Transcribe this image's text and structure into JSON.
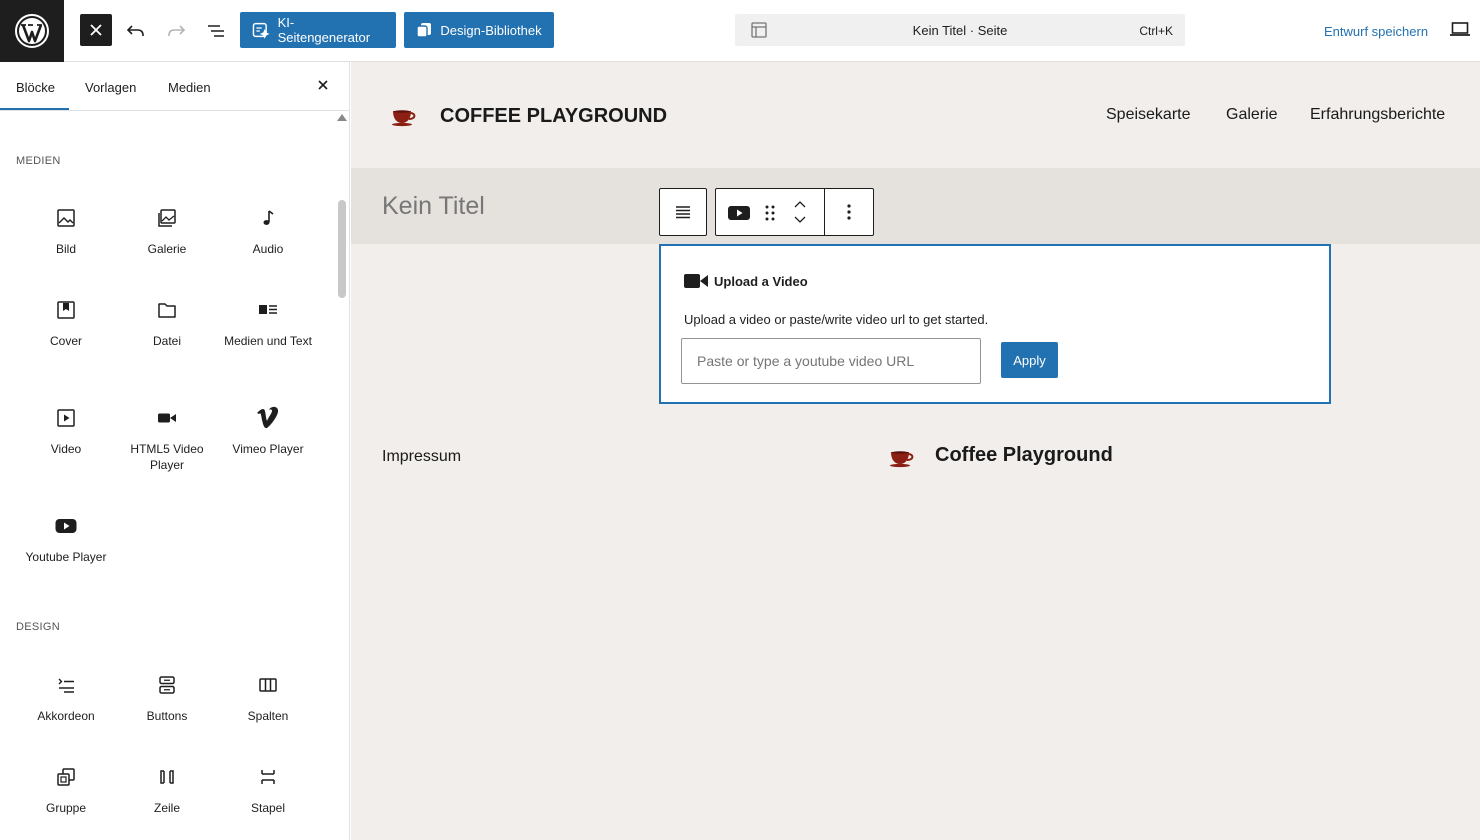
{
  "topbar": {
    "ki_button": "KI-Seitengenerator",
    "library_button": "Design-Bibliothek",
    "command_title": "Kein Titel · Seite",
    "command_shortcut": "Ctrl+K",
    "save_draft": "Entwurf speichern"
  },
  "sidebar": {
    "tabs": [
      "Blöcke",
      "Vorlagen",
      "Medien"
    ],
    "categories": {
      "media": "MEDIEN",
      "design": "DESIGN"
    },
    "blocks": {
      "bild": "Bild",
      "galerie": "Galerie",
      "audio": "Audio",
      "cover": "Cover",
      "datei": "Datei",
      "medien_text": "Medien und Text",
      "video": "Video",
      "html5_video": "HTML5 Video Player",
      "vimeo": "Vimeo Player",
      "youtube": "Youtube Player",
      "akkordeon": "Akkordeon",
      "buttons": "Buttons",
      "spalten": "Spalten",
      "gruppe": "Gruppe",
      "zeile": "Zeile",
      "stapel": "Stapel"
    }
  },
  "canvas": {
    "site_title": "COFFEE PLAYGROUND",
    "nav": [
      "Speisekarte",
      "Galerie",
      "Erfahrungsberichte"
    ],
    "page_title": "Kein Titel",
    "video_block": {
      "heading": "Upload a Video",
      "description": "Upload a video or paste/write video url to get started.",
      "input_placeholder": "Paste or type a youtube video URL",
      "apply": "Apply"
    },
    "footer_link": "Impressum",
    "footer_title": "Coffee Playground"
  },
  "colors": {
    "accent": "#2271b1",
    "canvas_bg": "#f1eeeb",
    "title_band": "#e5e2de",
    "coffee": "#8b1f14"
  }
}
